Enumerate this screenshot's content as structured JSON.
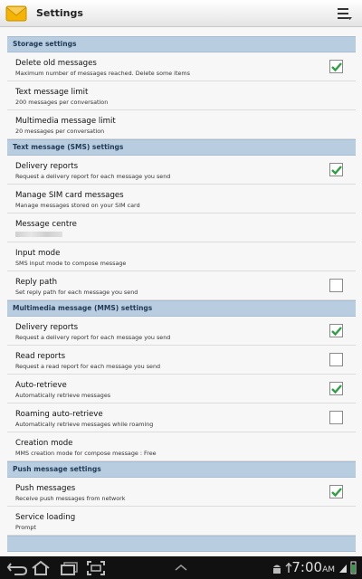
{
  "titlebar": {
    "title": "Settings",
    "app_icon": "envelope-icon",
    "menu_icon": "menu-icon"
  },
  "sections": [
    {
      "header": "Storage settings",
      "rows": [
        {
          "title": "Delete old messages",
          "subtitle": "Maximum number of messages reached. Delete some items",
          "checkbox": true,
          "checked": true
        },
        {
          "title": "Text message limit",
          "subtitle": "200 messages per conversation",
          "checkbox": false
        },
        {
          "title": "Multimedia message limit",
          "subtitle": "20 messages per conversation",
          "checkbox": false
        }
      ]
    },
    {
      "header": "Text message (SMS) settings",
      "rows": [
        {
          "title": "Delivery reports",
          "subtitle": "Request a delivery report for each message you send",
          "checkbox": true,
          "checked": true
        },
        {
          "title": "Manage SIM card messages",
          "subtitle": "Manage messages stored on your SIM card",
          "checkbox": false
        },
        {
          "title": "Message centre",
          "subtitle": "",
          "checkbox": false,
          "masked": true
        },
        {
          "title": "Input mode",
          "subtitle": "SMS input mode to compose message",
          "checkbox": false
        },
        {
          "title": "Reply path",
          "subtitle": "Set reply path for each message you send",
          "checkbox": true,
          "checked": false
        }
      ]
    },
    {
      "header": "Multimedia message (MMS) settings",
      "rows": [
        {
          "title": "Delivery reports",
          "subtitle": "Request a delivery report for each message you send",
          "checkbox": true,
          "checked": true
        },
        {
          "title": "Read reports",
          "subtitle": "Request a read report for each message you send",
          "checkbox": true,
          "checked": false
        },
        {
          "title": "Auto-retrieve",
          "subtitle": "Automatically retrieve messages",
          "checkbox": true,
          "checked": true
        },
        {
          "title": "Roaming auto-retrieve",
          "subtitle": "Automatically retrieve messages while roaming",
          "checkbox": true,
          "checked": false
        },
        {
          "title": "Creation mode",
          "subtitle": "MMS creation mode for compose message : Free",
          "checkbox": false
        }
      ]
    },
    {
      "header": "Push message settings",
      "rows": [
        {
          "title": "Push messages",
          "subtitle": "Receive push messages from network",
          "checkbox": true,
          "checked": true
        },
        {
          "title": "Service loading",
          "subtitle": "Prompt",
          "checkbox": false
        }
      ]
    }
  ],
  "navbar": {
    "time": "7:00",
    "ampm": "AM",
    "icons": [
      "back-icon",
      "home-icon",
      "recent-apps-icon",
      "screenshot-icon",
      "up-arrow-icon",
      "android-icon",
      "usb-icon",
      "signal-icon",
      "battery-icon"
    ]
  },
  "colors": {
    "section_header_bg": "#b8cde0",
    "check_green": "#2ea043"
  }
}
